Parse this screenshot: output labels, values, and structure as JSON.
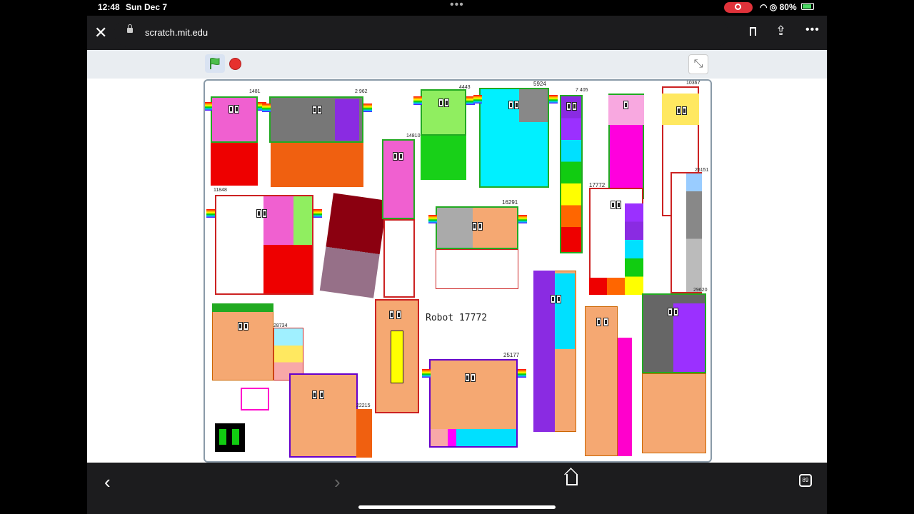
{
  "status_bar": {
    "time": "12:48",
    "date": "Sun Dec 7",
    "battery": "80%"
  },
  "browser": {
    "url": "scratch.mit.edu",
    "tab_count": "89"
  },
  "stage": {
    "caption": "Robot 17772",
    "labels": [
      "1481",
      "2 962",
      "4443",
      "5924",
      "7 405",
      "10367",
      "11848",
      "14810",
      "16291",
      "17772",
      "26151",
      "29620",
      "28734",
      "25177",
      "22215"
    ]
  }
}
